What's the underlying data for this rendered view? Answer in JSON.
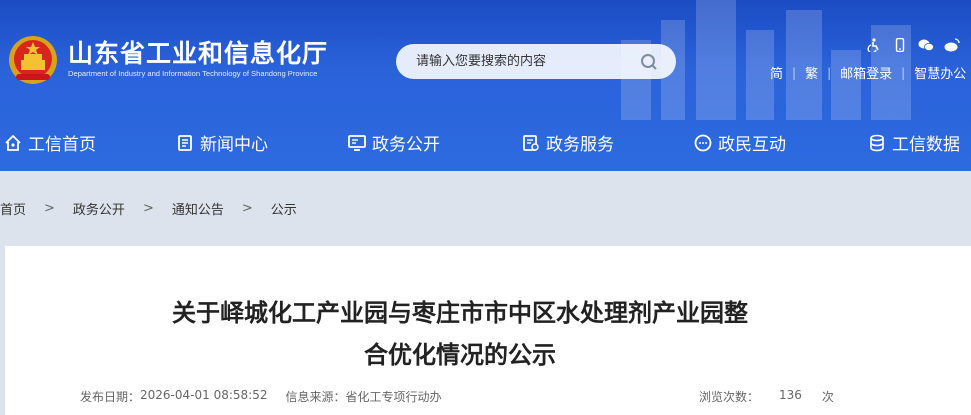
{
  "header": {
    "site_name_cn": "山东省工业和信息化厅",
    "site_name_en": "Department of Industry and Information Technology of Shandong Province",
    "search": {
      "placeholder": "请输入您要搜索的内容"
    },
    "tool_icons": [
      "accessibility-icon",
      "mobile-icon",
      "wechat-icon",
      "weibo-icon"
    ],
    "links": [
      "简",
      "繁",
      "邮箱登录",
      "智慧办公"
    ]
  },
  "nav": [
    {
      "label": "工信首页",
      "icon": "home-icon"
    },
    {
      "label": "新闻中心",
      "icon": "news-icon"
    },
    {
      "label": "政务公开",
      "icon": "monitor-icon"
    },
    {
      "label": "政务服务",
      "icon": "service-icon"
    },
    {
      "label": "政民互动",
      "icon": "chat-icon"
    },
    {
      "label": "工信数据",
      "icon": "database-icon"
    }
  ],
  "breadcrumb": {
    "items": [
      "首页",
      "政务公开",
      "通知公告",
      "公示"
    ],
    "separator": ">"
  },
  "article": {
    "title_line1": "关于峄城化工产业园与枣庄市市中区水处理剂产业园整",
    "title_line2": "合优化情况的公示",
    "publish_label": "发布日期：",
    "publish_date": "2026-04-01 08:58:52",
    "source_label": "信息来源：",
    "source": "省化工专项行动办",
    "views_label": "浏览次数：",
    "views": "136",
    "views_unit": "次"
  },
  "colors": {
    "header_blue": "#2a62da",
    "background": "#dde3ec",
    "card": "#ffffff"
  }
}
